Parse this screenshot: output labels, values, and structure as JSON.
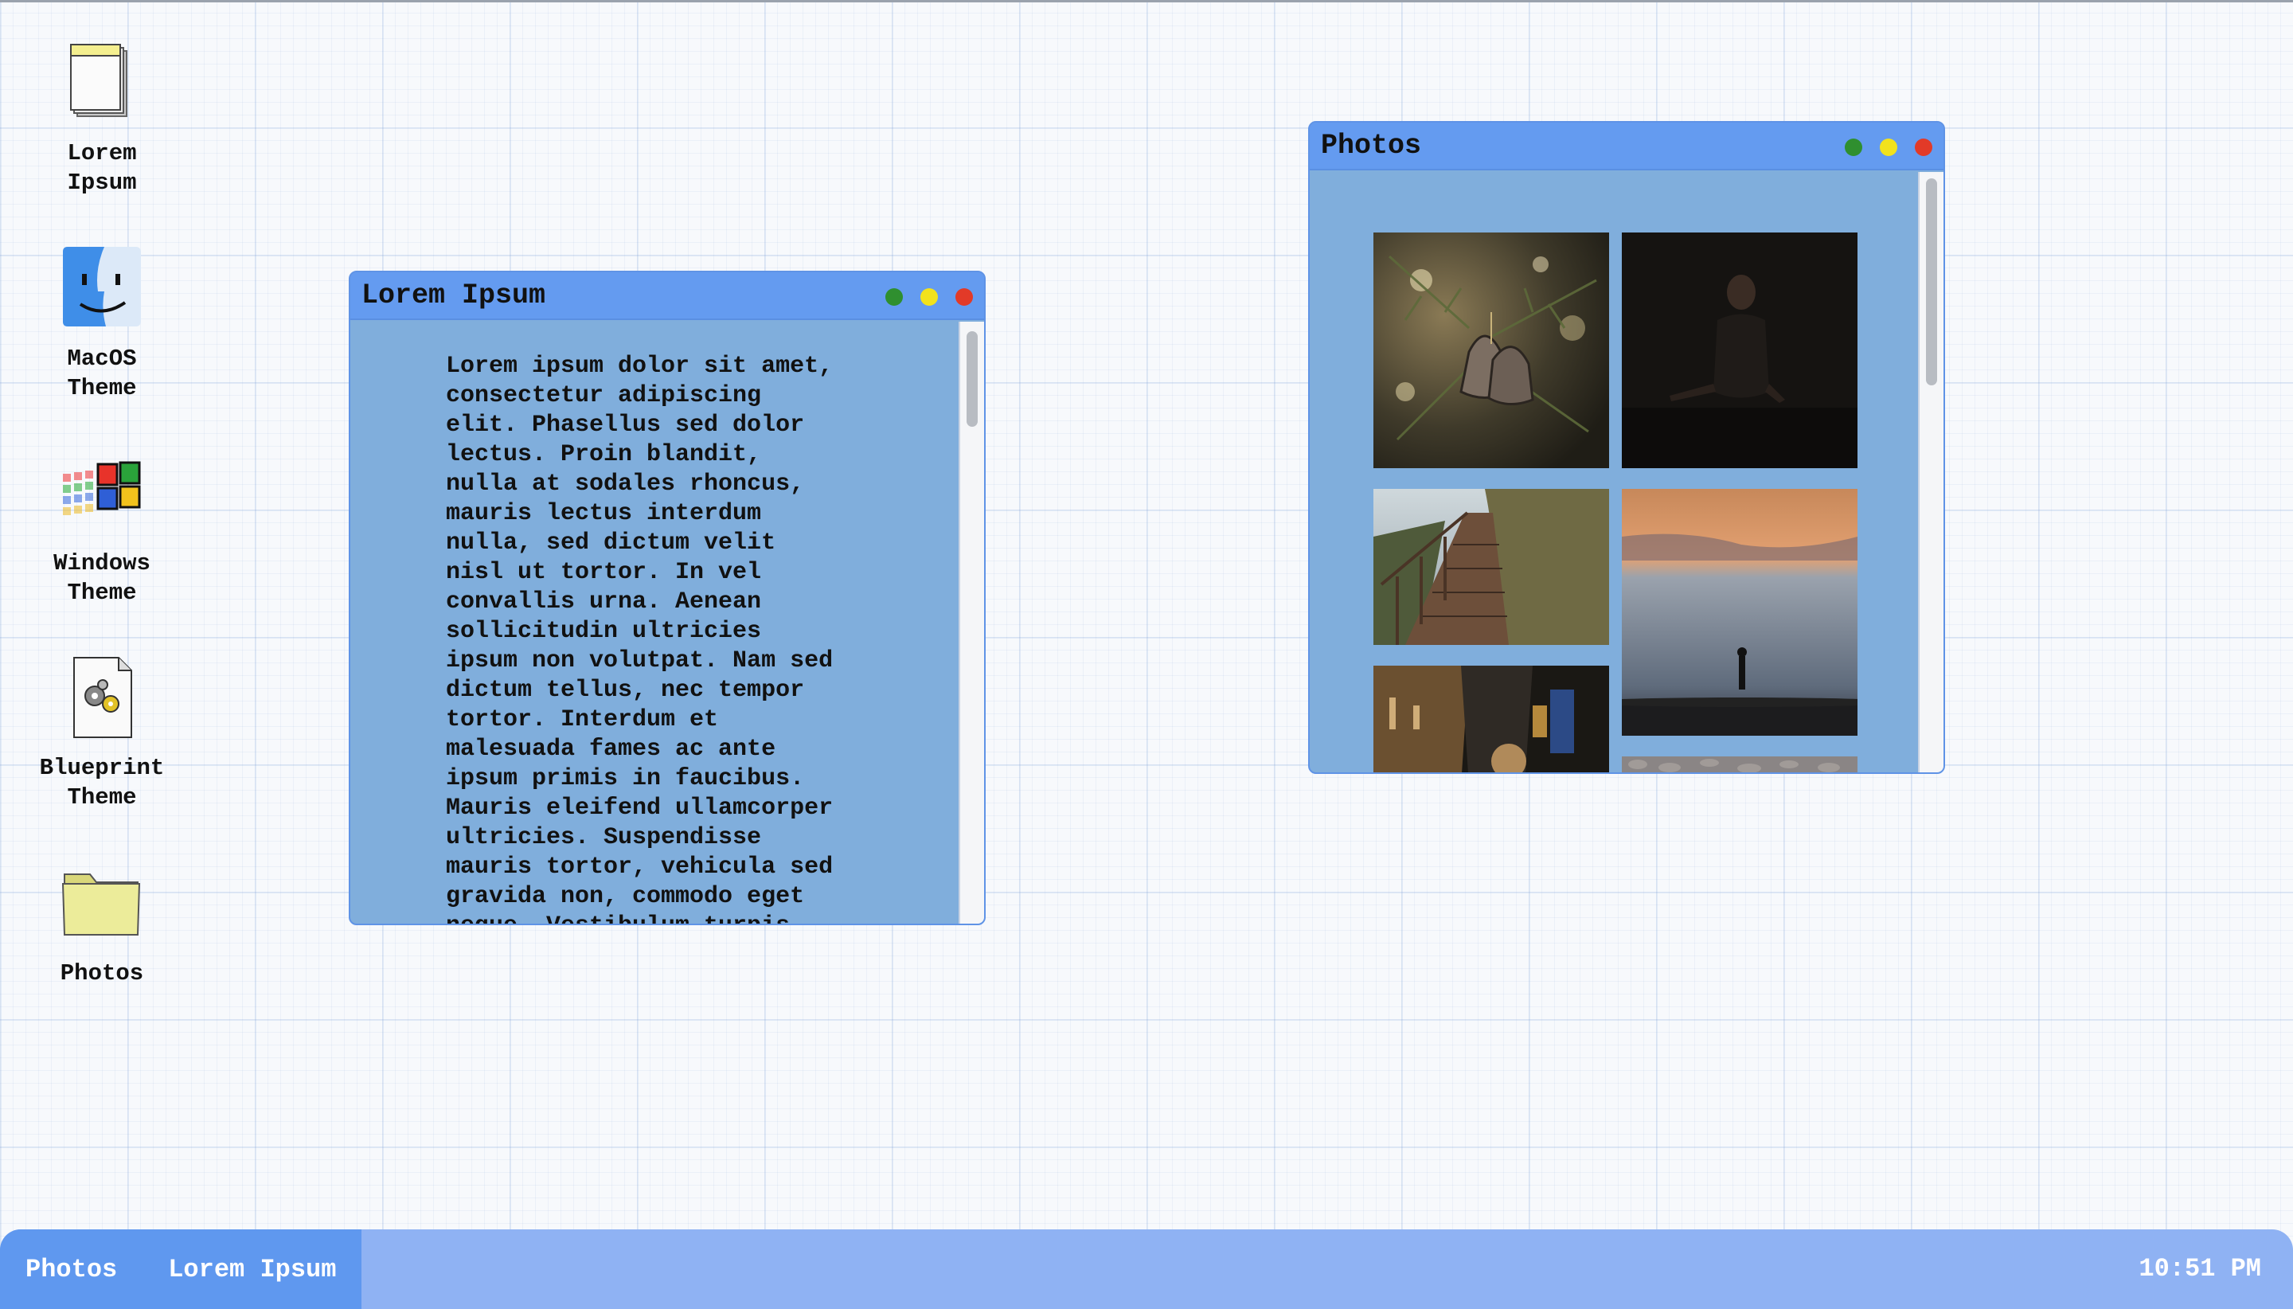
{
  "desktop": {
    "icons": [
      {
        "label_line1": "Lorem",
        "label_line2": "Ipsum",
        "icon": "notepad-icon"
      },
      {
        "label_line1": "MacOS",
        "label_line2": "Theme",
        "icon": "finder-face-icon"
      },
      {
        "label_line1": "Windows",
        "label_line2": "Theme",
        "icon": "windows-flag-icon"
      },
      {
        "label_line1": "Blueprint",
        "label_line2": "Theme",
        "icon": "settings-file-icon"
      },
      {
        "label_line1": "Photos",
        "label_line2": "",
        "icon": "folder-icon"
      }
    ]
  },
  "lorem_window": {
    "title": "Lorem Ipsum",
    "text": "Lorem ipsum dolor sit amet,\nconsectetur adipiscing\nelit. Phasellus sed dolor\nlectus. Proin blandit,\nnulla at sodales rhoncus,\nmauris lectus interdum\nnulla, sed dictum velit\nnisl ut tortor. In vel\nconvallis urna. Aenean\nsollicitudin ultricies\nipsum non volutpat. Nam sed\ndictum tellus, nec tempor\ntortor. Interdum et\nmalesuada fames ac ante\nipsum primis in faucibus.\nMauris eleifend ullamcorper\nultricies. Suspendisse\nmauris tortor, vehicula sed\ngravida non, commodo eget\nneque. Vestibulum turpis"
  },
  "photos_window": {
    "title": "Photos",
    "photos": [
      {
        "subject": "pine-bell-ornament"
      },
      {
        "subject": "dark-portrait"
      },
      {
        "subject": "boardwalk-path"
      },
      {
        "subject": "sunset-beach"
      },
      {
        "subject": "night-street"
      },
      {
        "subject": "pebbles"
      }
    ]
  },
  "taskbar": {
    "items": [
      "Photos",
      "Lorem Ipsum"
    ],
    "clock": "10:51 PM"
  },
  "colors": {
    "window_body": "#80aedc",
    "titlebar": "#649bf0",
    "taskbar": "#8fb2f3",
    "taskbar_group": "#5f98ef",
    "btn_green": "#2f8f2f",
    "btn_yellow": "#f2e21c",
    "btn_red": "#e23a28"
  }
}
